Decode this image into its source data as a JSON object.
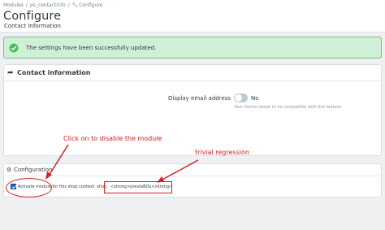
{
  "header": {
    "breadcrumb": [
      "Modules",
      "ps_contactinfo",
      "Configure"
    ],
    "breadcrumb_sep": "/",
    "title": "Configure",
    "subtitle": "Contact Information"
  },
  "alert": {
    "message": "The settings have been successfully updated.",
    "color": "#cff0d6",
    "icon": "check-circle-icon"
  },
  "contact_panel": {
    "title": "Contact information",
    "icon": "share-icon",
    "field": {
      "label": "Display email address",
      "toggle_value": "No",
      "toggle_on": false,
      "help": "Your theme needs to be compatible with this feature"
    }
  },
  "config_panel": {
    "title": "Configuration",
    "icon": "cogs-icon",
    "checkbox_checked": true,
    "checkbox_label": "Activate module for this shop context: shop",
    "shop_name_raw": "<strong>prestaBOx</strong>"
  },
  "annotations": {
    "note_1": "Click on to disable the module",
    "note_2": "trivial regression",
    "color": "#d42020"
  }
}
